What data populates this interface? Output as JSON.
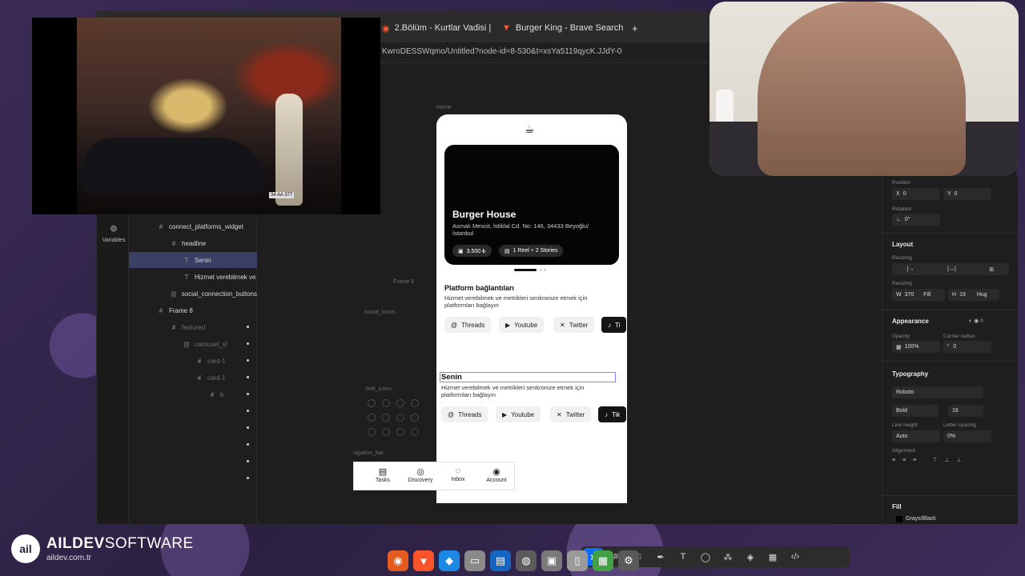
{
  "browser": {
    "tabs": [
      {
        "label": "2.Bölüm - Kurtlar Vadisi |"
      },
      {
        "label": "Burger King - Brave Search"
      }
    ],
    "new_tab": "+",
    "url": "KwroDESSWqmo/Untitled?node-id=8-530&t=xsYa5119qycK.JJdY-0"
  },
  "left_rail": {
    "variables_label": "Variables"
  },
  "layers": [
    {
      "label": "connect_platforms_widget",
      "glyph": "#"
    },
    {
      "label": "headline",
      "glyph": "#"
    },
    {
      "label": "Senin",
      "glyph": "T"
    },
    {
      "label": "Hizmet verebilmek ve",
      "glyph": "T"
    },
    {
      "label": "social_connection_buttons",
      "glyph": "|||"
    },
    {
      "label": "Frame 8",
      "glyph": "#"
    },
    {
      "label": "featured",
      "glyph": "#"
    },
    {
      "label": "carousel_sl",
      "glyph": "|||"
    },
    {
      "label": "card-1",
      "glyph": "#"
    },
    {
      "label": "card-1",
      "glyph": "#"
    },
    {
      "label": "b",
      "glyph": "#"
    },
    {
      "label": "",
      "glyph": ""
    },
    {
      "label": "",
      "glyph": ""
    },
    {
      "label": "",
      "glyph": ""
    },
    {
      "label": "",
      "glyph": ""
    },
    {
      "label": "",
      "glyph": ""
    }
  ],
  "canvas": {
    "frame_home": "Home",
    "frame_8": "Frame 8",
    "social_icons": "social_icons",
    "bnb_icons": "bnb_icons",
    "navigation_bar": "vigation_bar"
  },
  "phone": {
    "hero": {
      "title": "Burger House",
      "address": "Asmalı Mescit, İstiklal Cd. No: 146, 34433 Beyoğlu/ İstanbul",
      "price": "3.500 ₺",
      "stories": "1 Reel + 2 Stories"
    },
    "section1": {
      "title": "Platform bağlantıları",
      "desc": "Hizmet verebilmek ve metrikleri senkronize etmek için platformları bağlayın"
    },
    "section2": {
      "title": "Senin",
      "desc": "Hizmet verebilmek ve metrikleri senkronize etmek için platformları bağlayın"
    },
    "chips": {
      "threads": "Threads",
      "youtube": "Youtube",
      "twitter": "Twitter",
      "tiktok_a": "Ti",
      "tiktok_b": "Tik"
    }
  },
  "navbar": {
    "items": [
      {
        "label": "Tasks",
        "icon": "clipboard-icon"
      },
      {
        "label": "Discovery",
        "icon": "compass-icon"
      },
      {
        "label": "Inbox",
        "icon": "chat-icon"
      },
      {
        "label": "Account",
        "icon": "user-icon"
      }
    ]
  },
  "props": {
    "position": "Position",
    "x": "X",
    "x_val": "0",
    "y": "Y",
    "y_val": "0",
    "rotation": "Rotation",
    "rotation_val": "0°",
    "layout": "Layout",
    "resizing": "Resizing",
    "resizing2": "Resizing",
    "w": "W",
    "w_val": "370",
    "fill_mode": "Fill",
    "h": "H",
    "h_val": "19",
    "hug": "Hug",
    "appearance": "Appearance",
    "opacity": "Opacity",
    "opacity_val": "100%",
    "corner_radius": "Corner radius",
    "corner_val": "0",
    "typography": "Typography",
    "font": "Roboto",
    "weight": "Bold",
    "size": "16",
    "line_height": "Line height",
    "line_height_val": "Auto",
    "letter_spacing": "Letter spacing",
    "letter_spacing_val": "0%",
    "alignment": "Alignment",
    "fill": "Fill",
    "fill_style": "Grays/Black"
  },
  "brand": {
    "mark": "ail",
    "name_bold": "AILDEV",
    "name_light": "SOFTWARE",
    "url": "aildev.com.tr"
  },
  "video": {
    "plate": "34 AA 377"
  },
  "colors": {
    "accent": "#0d6efd",
    "selection": "#7b8cff"
  }
}
